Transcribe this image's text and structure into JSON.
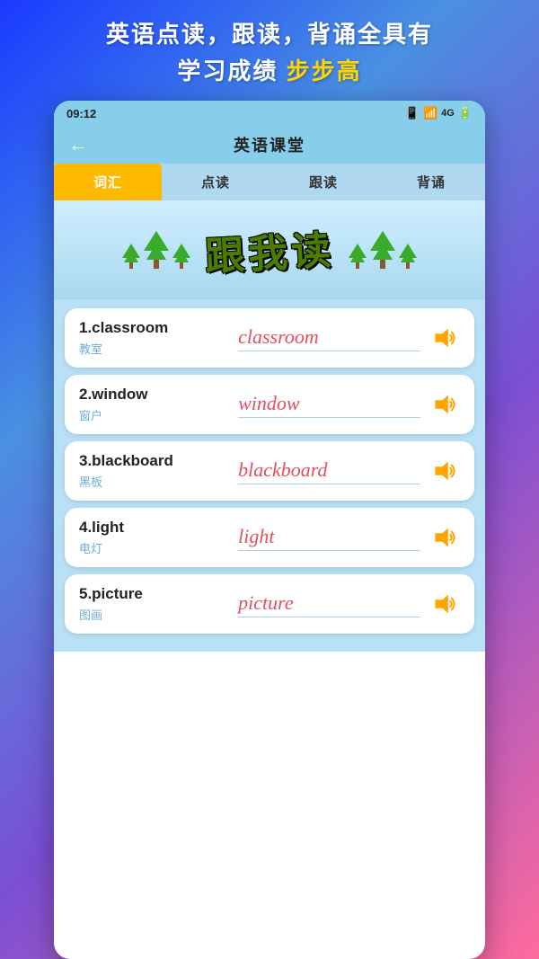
{
  "banner": {
    "line1": "英语点读，跟读，背诵全具有",
    "line2_prefix": "学习成绩",
    "line2_highlight": "步步高"
  },
  "statusBar": {
    "time": "09:12",
    "icons": "📶🔋"
  },
  "header": {
    "back": "←",
    "title": "英语课堂"
  },
  "tabs": [
    {
      "id": "vocab",
      "label": "词汇",
      "active": true
    },
    {
      "id": "read",
      "label": "点读",
      "active": false
    },
    {
      "id": "follow",
      "label": "跟读",
      "active": false
    },
    {
      "id": "recite",
      "label": "背诵",
      "active": false
    }
  ],
  "hero": {
    "text": "跟我读"
  },
  "words": [
    {
      "number": "1",
      "english": "classroom",
      "chinese": "教室",
      "display": "classroom"
    },
    {
      "number": "2",
      "english": "window",
      "chinese": "窗户",
      "display": "window"
    },
    {
      "number": "3",
      "english": "blackboard",
      "chinese": "黑板",
      "display": "blackboard"
    },
    {
      "number": "4",
      "english": "light",
      "chinese": "电灯",
      "display": "light"
    },
    {
      "number": "5",
      "english": "picture",
      "chinese": "图画",
      "display": "picture"
    }
  ]
}
